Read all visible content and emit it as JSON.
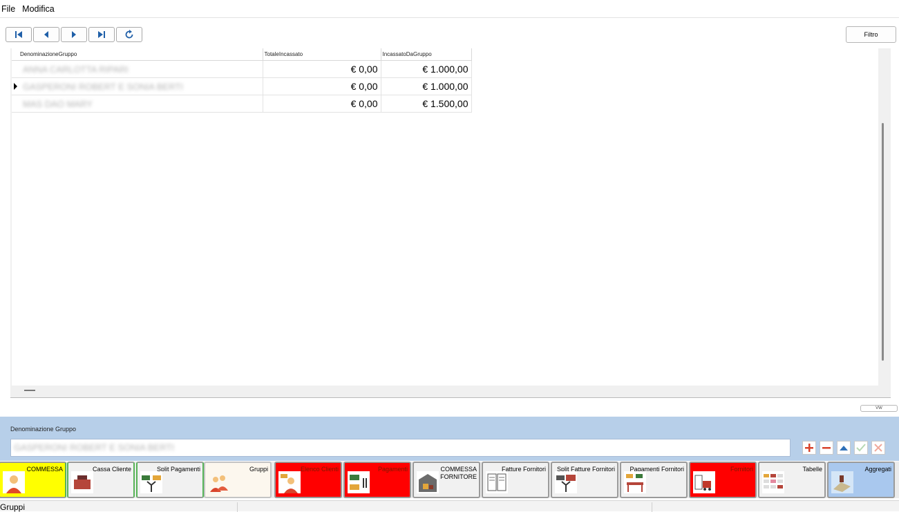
{
  "menu": {
    "file": "File",
    "modifica": "Modifica"
  },
  "toolbar": {
    "filter_label": "Filtro"
  },
  "grid": {
    "headers": [
      "DenominazioneGruppo",
      "TotaleIncassato",
      "IncassatoDaGruppo"
    ],
    "rows": [
      {
        "name": "ANNA CARLOTTA RIPARI",
        "totale": "€ 0,00",
        "incassato": "€ 1.000,00"
      },
      {
        "name": "GASPERONI ROBERT E SONIA BERTI",
        "totale": "€ 0,00",
        "incassato": "€ 1.000,00"
      },
      {
        "name": "MAS DAO MARY",
        "totale": "€ 0,00",
        "incassato": "€ 1.500,00"
      }
    ]
  },
  "view_button": "VW",
  "form": {
    "label": "Denominazione Gruppo",
    "value": "GASPERONI ROBERT E SONIA BERTI"
  },
  "tabs": [
    {
      "label": "COMMESSA",
      "icon": "person-icon",
      "color": "#ffff00"
    },
    {
      "label": "Cassa Cliente",
      "icon": "cash-register-icon",
      "color": "#f1f1f1"
    },
    {
      "label": "Split Pagamenti",
      "icon": "split-payment-icon",
      "color": "#f1f1f1"
    },
    {
      "label": "Gruppi",
      "icon": "group-icon",
      "color": "#fcf7ee"
    },
    {
      "label": "Elenco Clienti",
      "icon": "clients-icon",
      "color": "#ff0000"
    },
    {
      "label": "Pagamenti",
      "icon": "payments-icon",
      "color": "#ff0000"
    },
    {
      "label": "COMMESSA FORNITORE",
      "icon": "warehouse-icon",
      "color": "#f1f1f1"
    },
    {
      "label": "Fatture Fornitori",
      "icon": "invoice-icon",
      "color": "#f1f1f1"
    },
    {
      "label": "Split Fatture Fornitori",
      "icon": "split-invoice-icon",
      "color": "#f1f1f1"
    },
    {
      "label": "Pagamenti Fornitori",
      "icon": "supplier-payment-icon",
      "color": "#f1f1f1"
    },
    {
      "label": "Fornitori",
      "icon": "truck-icon",
      "color": "#ff0000"
    },
    {
      "label": "Tabelle",
      "icon": "table-icon",
      "color": "#f1f1f1"
    },
    {
      "label": "Aggregati",
      "icon": "aggregate-icon",
      "color": "#a9c8ee"
    }
  ],
  "status": {
    "text": "Gruppi"
  }
}
